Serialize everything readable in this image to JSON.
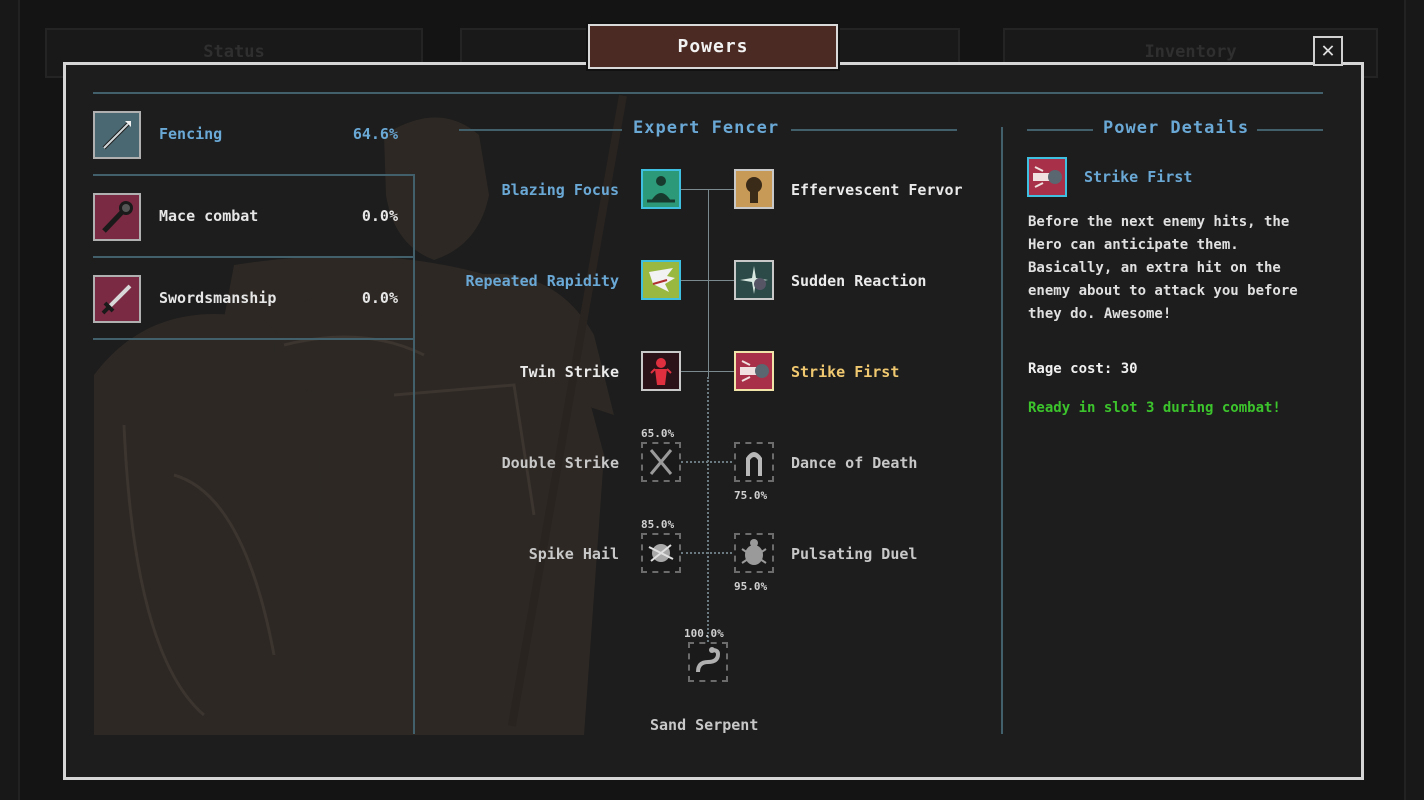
{
  "window": {
    "title": "Powers",
    "close_symbol": "✕",
    "tabs": {
      "left": "Status",
      "right": "Inventory"
    }
  },
  "colors": {
    "accent": "#6aa8d6",
    "gold": "#f0c870",
    "ready": "#3cc42c",
    "title_bg": "#4a2a22",
    "selected_border": "#40c0e0"
  },
  "skills": [
    {
      "name": "Fencing",
      "percent": "64.6%",
      "icon": "spear-icon",
      "active": true
    },
    {
      "name": "Mace combat",
      "percent": "0.0%",
      "icon": "mace-icon",
      "active": false
    },
    {
      "name": "Swordsmanship",
      "percent": "0.0%",
      "icon": "sword-icon",
      "active": false
    }
  ],
  "tree": {
    "title": "Expert Fencer",
    "powers": {
      "blazing_focus": {
        "name": "Blazing Focus",
        "icon": "meditation-icon",
        "state": "selected"
      },
      "effervescent_fervor": {
        "name": "Effervescent Fervor",
        "icon": "head-silhouette-icon",
        "state": "unlocked"
      },
      "repeated_rapidity": {
        "name": "Repeated Rapidity",
        "icon": "wing-icon",
        "state": "selected"
      },
      "sudden_reaction": {
        "name": "Sudden Reaction",
        "icon": "burst-icon",
        "state": "unlocked"
      },
      "twin_strike": {
        "name": "Twin Strike",
        "icon": "red-figure-icon",
        "state": "unlocked"
      },
      "strike_first": {
        "name": "Strike First",
        "icon": "fist-strike-icon",
        "state": "current"
      },
      "double_strike": {
        "name": "Double Strike",
        "percent": "65.0%",
        "icon": "crossed-swords-icon",
        "state": "locked"
      },
      "dance_of_death": {
        "name": "Dance of Death",
        "percent": "75.0%",
        "icon": "hooded-figure-icon",
        "state": "locked"
      },
      "spike_hail": {
        "name": "Spike Hail",
        "percent": "85.0%",
        "icon": "spike-ball-icon",
        "state": "locked"
      },
      "pulsating_duel": {
        "name": "Pulsating Duel",
        "percent": "95.0%",
        "icon": "beetle-icon",
        "state": "locked"
      },
      "sand_serpent": {
        "name": "Sand Serpent",
        "percent": "100.0%",
        "icon": "serpent-icon",
        "state": "locked"
      }
    }
  },
  "details": {
    "title": "Power Details",
    "name": "Strike First",
    "icon": "fist-strike-icon",
    "description": "Before the next enemy hits, the Hero can anticipate them. Basically, an extra hit on the enemy about to attack you before they do. Awesome!",
    "rage_cost": "Rage cost: 30",
    "status": "Ready in slot 3 during combat!"
  }
}
